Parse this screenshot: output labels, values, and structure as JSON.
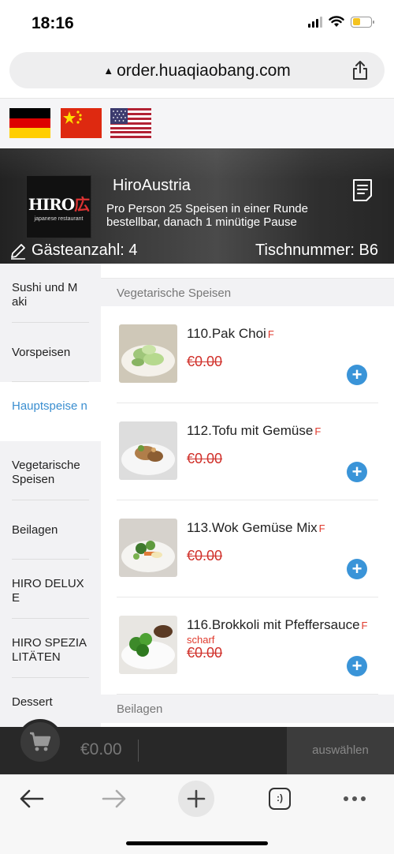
{
  "status": {
    "time": "18:16"
  },
  "browser": {
    "url": "order.huaqiaobang.com"
  },
  "languages": [
    "Deutsch",
    "中文",
    "English"
  ],
  "restaurant": {
    "name": "HiroAustria",
    "description": "Pro Person 25 Speisen in einer Runde bestellbar, danach 1 minütige Pause",
    "logo_text": "HIRO",
    "logo_char": "広",
    "logo_sub": "japanese restaurant",
    "guests_label": "Gästeanzahl: 4",
    "table_label": "Tischnummer: B6"
  },
  "categories": [
    {
      "label": "Sushi und M aki",
      "active": false
    },
    {
      "label": "Vorspeisen",
      "active": false
    },
    {
      "label": "Hauptspeise n",
      "active": true
    },
    {
      "label": "Vegetarische Speisen",
      "active": false
    },
    {
      "label": "Beilagen",
      "active": false
    },
    {
      "label": "HIRO DELUX E",
      "active": false
    },
    {
      "label": "HIRO SPEZIA LITÄTEN",
      "active": false
    },
    {
      "label": "Dessert",
      "active": false
    }
  ],
  "section": {
    "title": "Vegetarische Speisen",
    "next_title": "Beilagen"
  },
  "items": [
    {
      "name": "110.Pak Choi",
      "marker": "F",
      "tag": "",
      "price": "€0.00"
    },
    {
      "name": "112.Tofu mit Gemüse",
      "marker": "F",
      "tag": "",
      "price": "€0.00"
    },
    {
      "name": "113.Wok Gemüse Mix",
      "marker": "F",
      "tag": "",
      "price": "€0.00"
    },
    {
      "name": "116.Brokkoli mit Pfeffersauce",
      "marker": "F",
      "tag": "scharf",
      "price": "€0.00"
    }
  ],
  "cart": {
    "total": "€0.00",
    "choose_label": "auswählen"
  },
  "colors": {
    "accent": "#3a94d8",
    "price": "#d0302a",
    "cart_bg": "#282828"
  },
  "icons": [
    "lock-icon",
    "share-icon",
    "document-icon",
    "pencil-icon",
    "plus-circle-icon",
    "cart-icon",
    "back-arrow-icon",
    "forward-arrow-icon",
    "new-tab-icon",
    "tabs-icon",
    "more-icon"
  ]
}
